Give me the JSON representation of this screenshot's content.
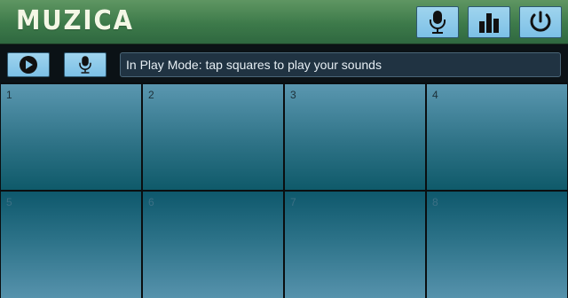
{
  "header": {
    "title": "MUZICA",
    "buttons": [
      {
        "icon": "microphone-icon"
      },
      {
        "icon": "bar-chart-icon"
      },
      {
        "icon": "power-icon"
      }
    ]
  },
  "controls": {
    "play_icon": "play-icon",
    "record_icon": "microphone-icon",
    "status_text": "In Play Mode: tap squares to play your sounds"
  },
  "pads": [
    {
      "label": "1"
    },
    {
      "label": "2"
    },
    {
      "label": "3"
    },
    {
      "label": "4"
    },
    {
      "label": "5"
    },
    {
      "label": "6"
    },
    {
      "label": "7"
    },
    {
      "label": "8"
    }
  ],
  "colors": {
    "header_green": "#3d7a4a",
    "button_blue": "#86c6e8",
    "pad_teal": "#2f7387"
  }
}
